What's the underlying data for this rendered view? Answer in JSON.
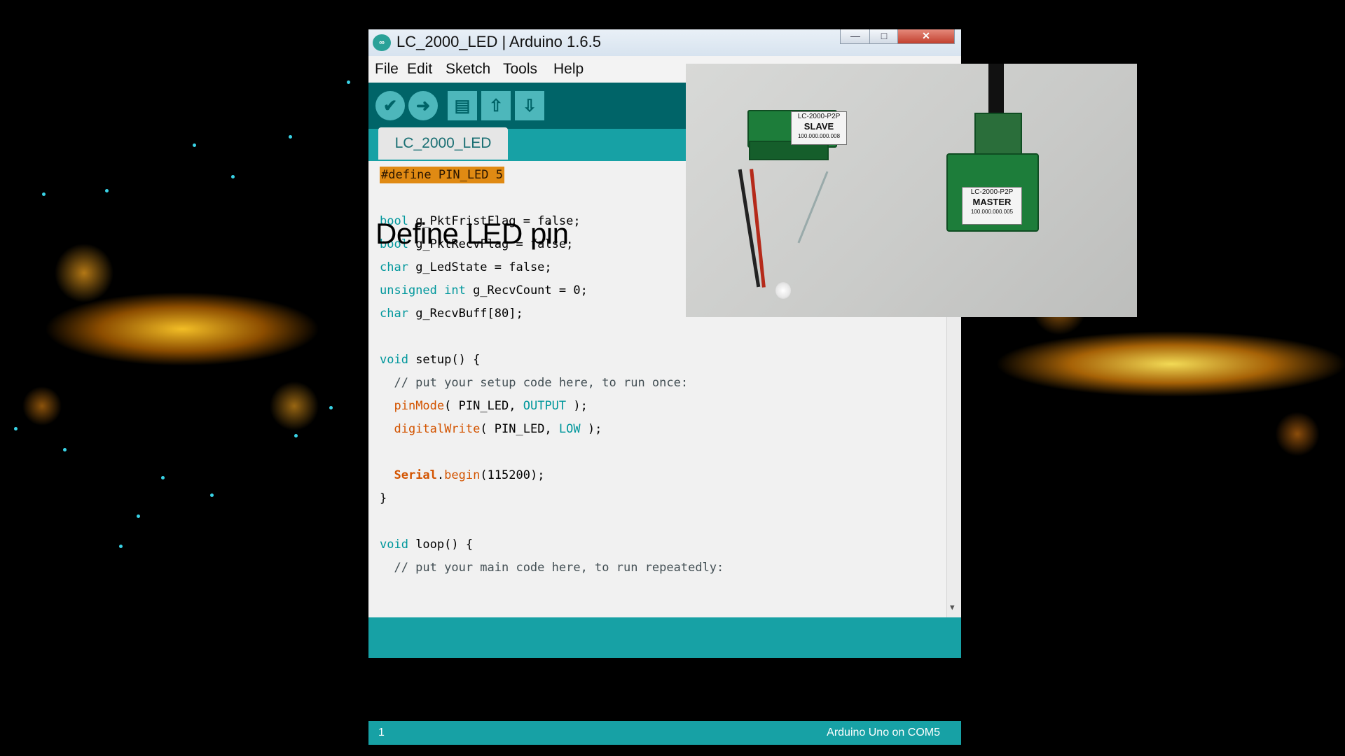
{
  "window": {
    "title": "LC_2000_LED | Arduino 1.6.5",
    "app_icon": "∞",
    "controls": {
      "minimize": "—",
      "maximize": "□",
      "close": "✕"
    }
  },
  "menu": {
    "items": [
      "File",
      "Edit",
      "Sketch",
      "Tools",
      "Help"
    ]
  },
  "toolbar": {
    "verify_icon": "✔",
    "upload_icon": "➜",
    "new_icon": "▤",
    "open_icon": "⇧",
    "save_icon": "⇩"
  },
  "tabs": [
    {
      "label": "LC_2000_LED"
    }
  ],
  "annotation": "Define LED pin",
  "code": {
    "line1": "#define PIN_LED 5",
    "line2_type": "bool",
    "line2_rest": " g_PktFristFlag = false;",
    "line3_type": "bool",
    "line3_rest": " g_PktRecvFlag = false;",
    "line4_type": "char",
    "line4_rest": " g_LedState = false;",
    "line5_type": "unsigned int",
    "line5_rest": " g_RecvCount = 0;",
    "line6_type": "char",
    "line6_rest": " g_RecvBuff[80];",
    "line7_type": "void",
    "line7_rest": " setup() {",
    "line8": "  // put your setup code here, to run once:",
    "line9_fn": "pinMode",
    "line9_a": "( PIN_LED, ",
    "line9_const": "OUTPUT",
    "line9_b": " );",
    "line10_fn": "digitalWrite",
    "line10_a": "( PIN_LED, ",
    "line10_const": "LOW",
    "line10_b": " );",
    "line11_obj": "Serial",
    "line11_dot": ".",
    "line11_fn": "begin",
    "line11_rest": "(115200);",
    "line12": "}",
    "line13_type": "void",
    "line13_rest": " loop() {",
    "line14": "  // put your main code here, to run repeatedly:"
  },
  "status": {
    "line_number": "1",
    "board": "Arduino Uno on COM5"
  },
  "photo": {
    "slave_label": "SLAVE",
    "slave_model": "LC-2000-P2P",
    "slave_id": "100.000.000.008",
    "master_label": "MASTER",
    "master_model": "LC-2000-P2P",
    "master_id": "100.000.000.005"
  },
  "colors": {
    "toolbar": "#006468",
    "accent": "#17a1a5",
    "highlight": "#e08a13"
  }
}
